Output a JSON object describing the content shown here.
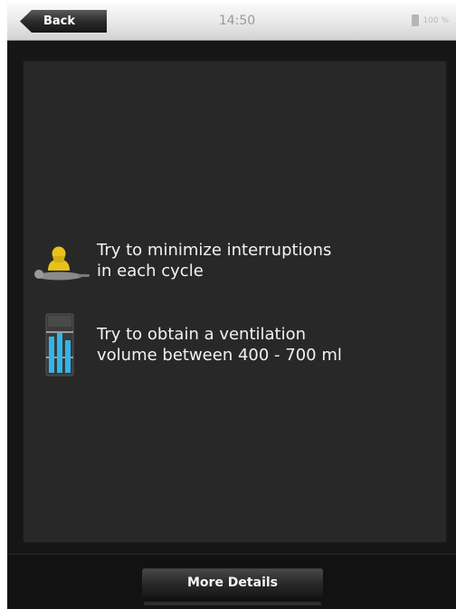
{
  "statusbar": {
    "back_label": "Back",
    "time": "14:50",
    "battery_text": "100 %"
  },
  "tips": [
    {
      "icon": "hands-on-chest-icon",
      "text": "Try to minimize interruptions\nin each cycle"
    },
    {
      "icon": "ventilation-volume-icon",
      "text": "Try to obtain a ventilation\nvolume between 400 - 700 ml"
    }
  ],
  "footer": {
    "more_details_label": "More Details"
  },
  "colors": {
    "accent_yellow": "#e8c21a",
    "accent_blue": "#2fb6ea"
  }
}
